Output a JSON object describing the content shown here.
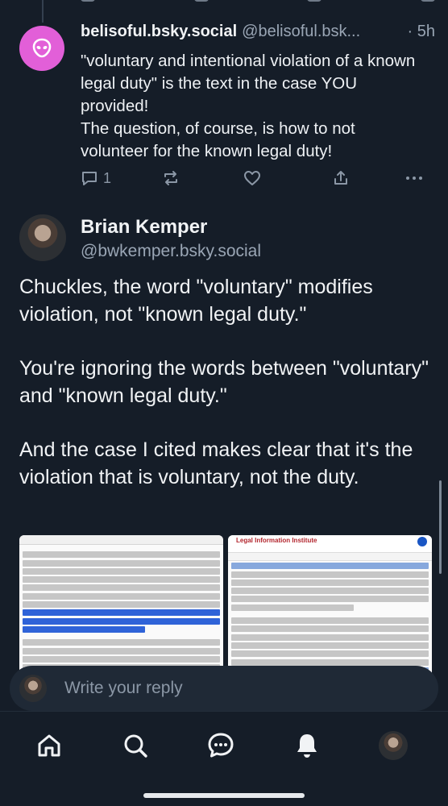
{
  "reply_post": {
    "display_name": "belisoful.bsky.social",
    "handle": "@belisoful.bsk...",
    "time": "· 5h",
    "text": "\"voluntary and intentional violation of a known legal duty\" is the text in the case YOU provided!\nThe question, of course, is how to not volunteer for the known legal duty!",
    "reply_count": "1",
    "avatar_icon": "alien-icon",
    "avatar_color": "#e25fd8"
  },
  "main_post": {
    "display_name": "Brian Kemper",
    "handle": "@bwkemper.bsky.social",
    "paragraphs": [
      "Chuckles, the word \"voluntary\" modifies violation, not \"known legal duty.\"",
      "You're ignoring the words between \"voluntary\" and \"known legal duty.\"",
      "And the case I cited makes clear that it's the violation that is voluntary, not the duty."
    ],
    "image_2_site_title": "Legal Information Institute"
  },
  "compose": {
    "placeholder": "Write your reply"
  },
  "tabbar": {
    "items": [
      "home-icon",
      "search-icon",
      "chat-icon",
      "bell-icon",
      "profile-avatar"
    ]
  },
  "colors": {
    "background": "#151d28",
    "muted": "#8b97a6",
    "accent_avatar": "#e25fd8"
  }
}
